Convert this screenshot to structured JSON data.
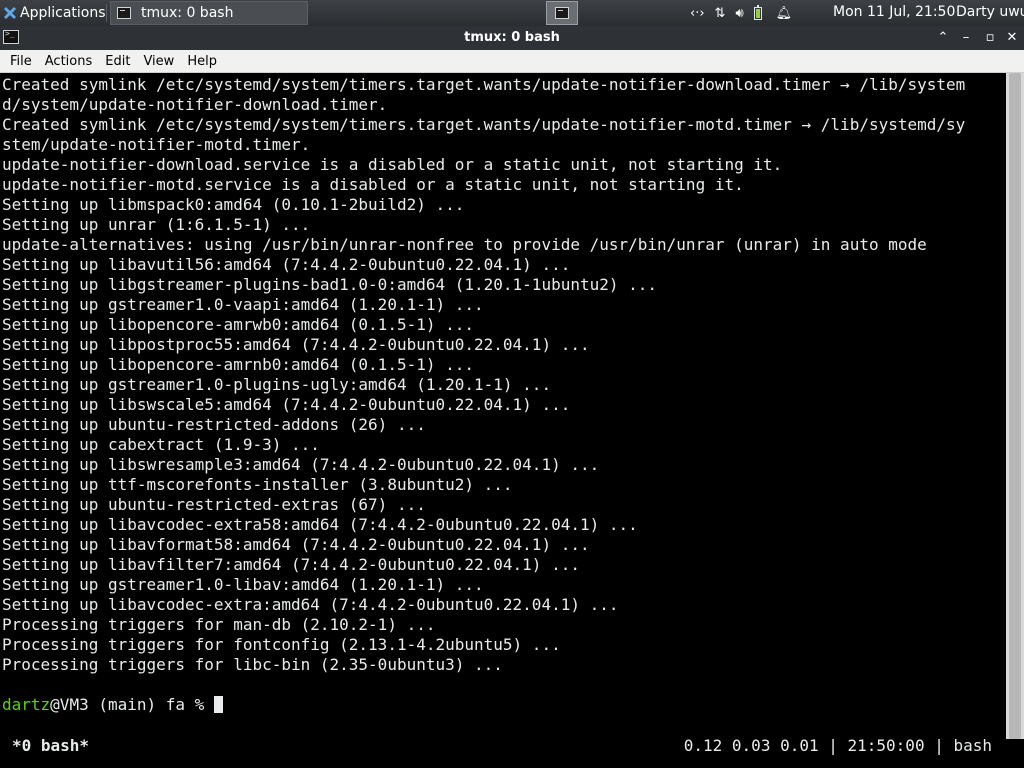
{
  "panel": {
    "apps_label": "Applications",
    "task_label": "tmux: 0 bash",
    "clock": "Mon 11 Jul, 21:50",
    "user": "Darty uwu",
    "icons": [
      "network-icon",
      "transfer-icon",
      "volume-icon",
      "battery-icon",
      "notification-bell-icon"
    ]
  },
  "window": {
    "title": "tmux: 0 bash"
  },
  "menu": {
    "file": "File",
    "actions": "Actions",
    "edit": "Edit",
    "view": "View",
    "help": "Help"
  },
  "terminal": {
    "lines": [
      "Created symlink /etc/systemd/system/timers.target.wants/update-notifier-download.timer → /lib/system",
      "d/system/update-notifier-download.timer.",
      "Created symlink /etc/systemd/system/timers.target.wants/update-notifier-motd.timer → /lib/systemd/sy",
      "stem/update-notifier-motd.timer.",
      "update-notifier-download.service is a disabled or a static unit, not starting it.",
      "update-notifier-motd.service is a disabled or a static unit, not starting it.",
      "Setting up libmspack0:amd64 (0.10.1-2build2) ...",
      "Setting up unrar (1:6.1.5-1) ...",
      "update-alternatives: using /usr/bin/unrar-nonfree to provide /usr/bin/unrar (unrar) in auto mode",
      "Setting up libavutil56:amd64 (7:4.4.2-0ubuntu0.22.04.1) ...",
      "Setting up libgstreamer-plugins-bad1.0-0:amd64 (1.20.1-1ubuntu2) ...",
      "Setting up gstreamer1.0-vaapi:amd64 (1.20.1-1) ...",
      "Setting up libopencore-amrwb0:amd64 (0.1.5-1) ...",
      "Setting up libpostproc55:amd64 (7:4.4.2-0ubuntu0.22.04.1) ...",
      "Setting up libopencore-amrnb0:amd64 (0.1.5-1) ...",
      "Setting up gstreamer1.0-plugins-ugly:amd64 (1.20.1-1) ...",
      "Setting up libswscale5:amd64 (7:4.4.2-0ubuntu0.22.04.1) ...",
      "Setting up ubuntu-restricted-addons (26) ...",
      "Setting up cabextract (1.9-3) ...",
      "Setting up libswresample3:amd64 (7:4.4.2-0ubuntu0.22.04.1) ...",
      "Setting up ttf-mscorefonts-installer (3.8ubuntu2) ...",
      "Setting up ubuntu-restricted-extras (67) ...",
      "Setting up libavcodec-extra58:amd64 (7:4.4.2-0ubuntu0.22.04.1) ...",
      "Setting up libavformat58:amd64 (7:4.4.2-0ubuntu0.22.04.1) ...",
      "Setting up libavfilter7:amd64 (7:4.4.2-0ubuntu0.22.04.1) ...",
      "Setting up gstreamer1.0-libav:amd64 (1.20.1-1) ...",
      "Setting up libavcodec-extra:amd64 (7:4.4.2-0ubuntu0.22.04.1) ...",
      "Processing triggers for man-db (2.10.2-1) ...",
      "Processing triggers for fontconfig (2.13.1-4.2ubuntu5) ...",
      "Processing triggers for libc-bin (2.35-0ubuntu3) ..."
    ],
    "prompt_user": "dartz",
    "prompt_rest": "@VM3 (main) fa % "
  },
  "status": {
    "window_name": "*0 bash*",
    "right": "0.12 0.03 0.01 | 21:50:00 | bash"
  },
  "colors": {
    "prompt_user": "#55d31e",
    "terminal_bg": "#000000",
    "terminal_fg": "#e9ebec"
  }
}
